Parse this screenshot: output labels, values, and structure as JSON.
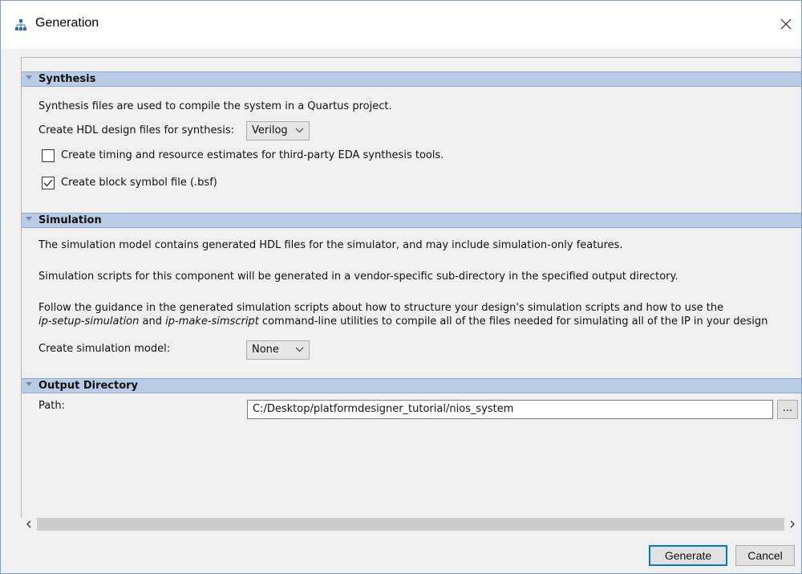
{
  "window": {
    "title": "Generation",
    "icon": "hierarchy-icon",
    "close_icon": "close-icon"
  },
  "synthesis": {
    "header": "Synthesis",
    "description": "Synthesis files are used to compile the system in a Quartus project.",
    "hdl_label": "Create HDL design files for synthesis:",
    "hdl_value": "Verilog",
    "timing_checkbox_label": "Create timing and resource estimates for third-party EDA synthesis tools.",
    "timing_checked": false,
    "bsf_checkbox_label": "Create block symbol file (.bsf)",
    "bsf_checked": true
  },
  "simulation": {
    "header": "Simulation",
    "line1": "The simulation model contains generated HDL files for the simulator, and may include simulation-only features.",
    "line2": "Simulation scripts for this component will be generated in a vendor-specific sub-directory in the specified output directory.",
    "line3": "Follow the guidance in the generated simulation scripts about how to structure your design's simulation scripts and how to use the",
    "line4_util1": "ip-setup-simulation",
    "line4_and": " and ",
    "line4_util2": "ip-make-simscript",
    "line4_rest": " command-line utilities to compile all of the files needed for simulating all of the IP in your design",
    "model_label": "Create simulation model:",
    "model_value": "None"
  },
  "output": {
    "header": "Output Directory",
    "path_label": "Path:",
    "path_value": "C:/Desktop/platformdesigner_tutorial/nios_system",
    "browse_label": "..."
  },
  "buttons": {
    "generate": "Generate",
    "cancel": "Cancel"
  },
  "colors": {
    "section_header_bg": "#b9cce5",
    "primary_border": "#0078d7"
  }
}
